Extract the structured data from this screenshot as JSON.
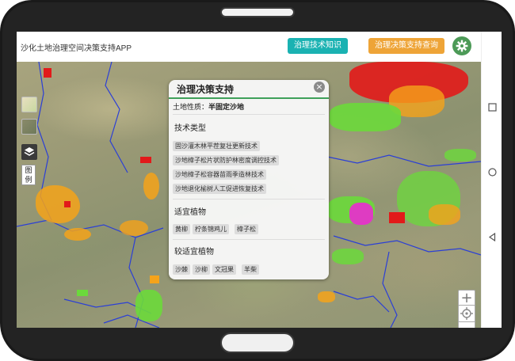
{
  "app": {
    "title": "沙化土地治理空间决策支持APP",
    "buttons": {
      "knowledge_base": "治理技术知识库",
      "decision_query": "治理决策支持查询"
    },
    "colors": {
      "teal": "#1ab2b2",
      "orange": "#eea437",
      "green": "#4c9a57"
    }
  },
  "map": {
    "legend_label": "图例",
    "layer_icons": [
      "map-thumbnail-icon",
      "satellite-thumbnail-icon",
      "layers-icon"
    ],
    "zoom_in": "+",
    "zoom_out": "−"
  },
  "popup": {
    "title": "治理决策支持",
    "close": "×",
    "land_label": "土地性质：",
    "land_value": "半固定沙地",
    "sections": [
      {
        "heading": "技术类型",
        "items": [
          "固沙灌木林平茬复壮更新技术",
          "沙地樟子松片状防护林密度调控技术",
          "沙地樟子松容器苗雨季造林技术",
          "沙地退化榆树人工促进恢复技术"
        ]
      },
      {
        "heading": "适宜植物",
        "items": [
          "黄柳",
          "柠条锦鸡儿",
          "樟子松"
        ]
      },
      {
        "heading": "较适宜植物",
        "items": [
          "沙棘",
          "沙柳",
          "文冠果",
          "羊柴"
        ]
      }
    ]
  },
  "system_nav": [
    "recent-apps-icon",
    "home-circle-icon",
    "back-triangle-icon"
  ]
}
